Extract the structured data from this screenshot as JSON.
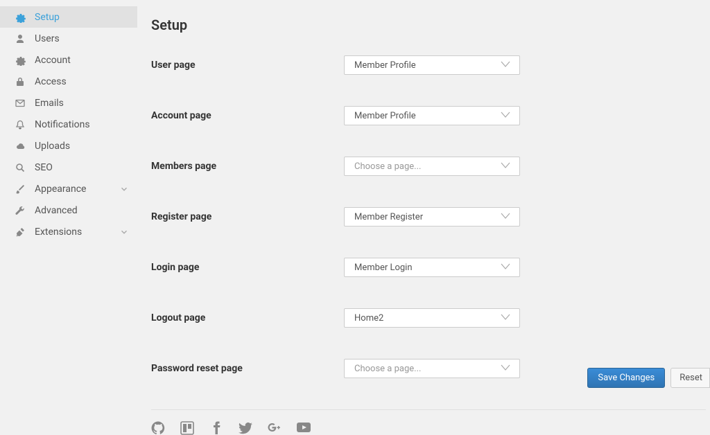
{
  "sidebar": {
    "items": [
      {
        "label": "Setup",
        "icon": "gear",
        "active": true,
        "hasChevron": false
      },
      {
        "label": "Users",
        "icon": "user",
        "active": false,
        "hasChevron": false
      },
      {
        "label": "Account",
        "icon": "gear",
        "active": false,
        "hasChevron": false
      },
      {
        "label": "Access",
        "icon": "lock",
        "active": false,
        "hasChevron": false
      },
      {
        "label": "Emails",
        "icon": "mail",
        "active": false,
        "hasChevron": false
      },
      {
        "label": "Notifications",
        "icon": "bell",
        "active": false,
        "hasChevron": false
      },
      {
        "label": "Uploads",
        "icon": "cloud",
        "active": false,
        "hasChevron": false
      },
      {
        "label": "SEO",
        "icon": "search",
        "active": false,
        "hasChevron": false
      },
      {
        "label": "Appearance",
        "icon": "brush",
        "active": false,
        "hasChevron": true
      },
      {
        "label": "Advanced",
        "icon": "wrench",
        "active": false,
        "hasChevron": false
      },
      {
        "label": "Extensions",
        "icon": "plug",
        "active": false,
        "hasChevron": true
      }
    ]
  },
  "page": {
    "title": "Setup"
  },
  "form": {
    "rows": [
      {
        "label": "User page",
        "value": "Member Profile",
        "placeholder": false
      },
      {
        "label": "Account page",
        "value": "Member Profile",
        "placeholder": false
      },
      {
        "label": "Members page",
        "value": "Choose a page...",
        "placeholder": true
      },
      {
        "label": "Register page",
        "value": "Member Register",
        "placeholder": false
      },
      {
        "label": "Login page",
        "value": "Member Login",
        "placeholder": false
      },
      {
        "label": "Logout page",
        "value": "Home2",
        "placeholder": false
      },
      {
        "label": "Password reset page",
        "value": "Choose a page...",
        "placeholder": true
      }
    ]
  },
  "social": [
    "github",
    "trello",
    "facebook",
    "twitter",
    "gplus",
    "youtube"
  ],
  "footer": {
    "save": "Save Changes",
    "reset": "Reset"
  }
}
